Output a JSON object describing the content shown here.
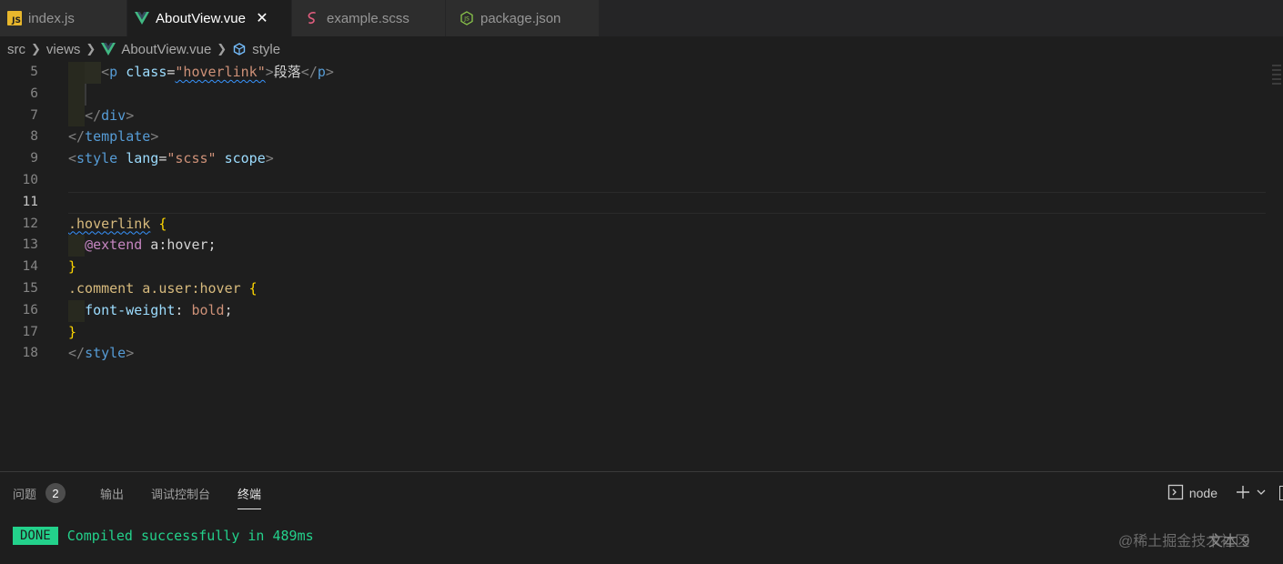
{
  "tabs": [
    {
      "label": "index.js",
      "icon": "js-file-icon"
    },
    {
      "label": "AboutView.vue",
      "icon": "vue-file-icon",
      "close": "✕"
    },
    {
      "label": "example.scss",
      "icon": "scss-file-icon"
    },
    {
      "label": "package.json",
      "icon": "nodejs-file-icon"
    }
  ],
  "breadcrumb": {
    "items": [
      "src",
      "views",
      "AboutView.vue",
      "style"
    ]
  },
  "editor": {
    "line_numbers": [
      "5",
      "6",
      "7",
      "8",
      "9",
      "10",
      "11",
      "12",
      "13",
      "14",
      "15",
      "16",
      "17",
      "18"
    ],
    "current_line": "11",
    "code": {
      "l5": {
        "open": "<",
        "tag": "p",
        "attr": " class",
        "eq": "=",
        "str": "\"hoverlink\"",
        "close": ">",
        "text": "段落",
        "end": "</",
        "endtag": "p",
        "endclose": ">"
      },
      "l7": {
        "open": "</",
        "tag": "div",
        "close": ">"
      },
      "l8": {
        "open": "</",
        "tag": "template",
        "close": ">"
      },
      "l9": {
        "open": "<",
        "tag": "style",
        "attr1": " lang",
        "eq": "=",
        "str": "\"scss\"",
        "attr2": " scope",
        "close": ">"
      },
      "l12": {
        "sel": ".hoverlink",
        "brace": " {"
      },
      "l13": {
        "at": "@extend",
        "rest": " a:hover;"
      },
      "l14": {
        "brace": "}"
      },
      "l15": {
        "sel": ".comment a.user:hover",
        "brace": " {"
      },
      "l16": {
        "prop": "font-weight",
        "colon": ": ",
        "val": "bold",
        "semi": ";"
      },
      "l17": {
        "brace": "}"
      },
      "l18": {
        "open": "</",
        "tag": "style",
        "close": ">"
      }
    }
  },
  "panel": {
    "tabs": [
      {
        "label": "问题",
        "badge": "2"
      },
      {
        "label": "输出"
      },
      {
        "label": "调试控制台"
      },
      {
        "label": "终端"
      }
    ],
    "terminal_name": "node",
    "done_label": "DONE",
    "message": "Compiled successfully in 489ms",
    "watermark": "@稀土掘金技术社区",
    "overlay_text": "文本 9"
  },
  "colors": {
    "editor_bg": "#1e1e1e",
    "tab_bar_bg": "#252526",
    "success": "#23d18b",
    "vue_green": "#41b883"
  }
}
